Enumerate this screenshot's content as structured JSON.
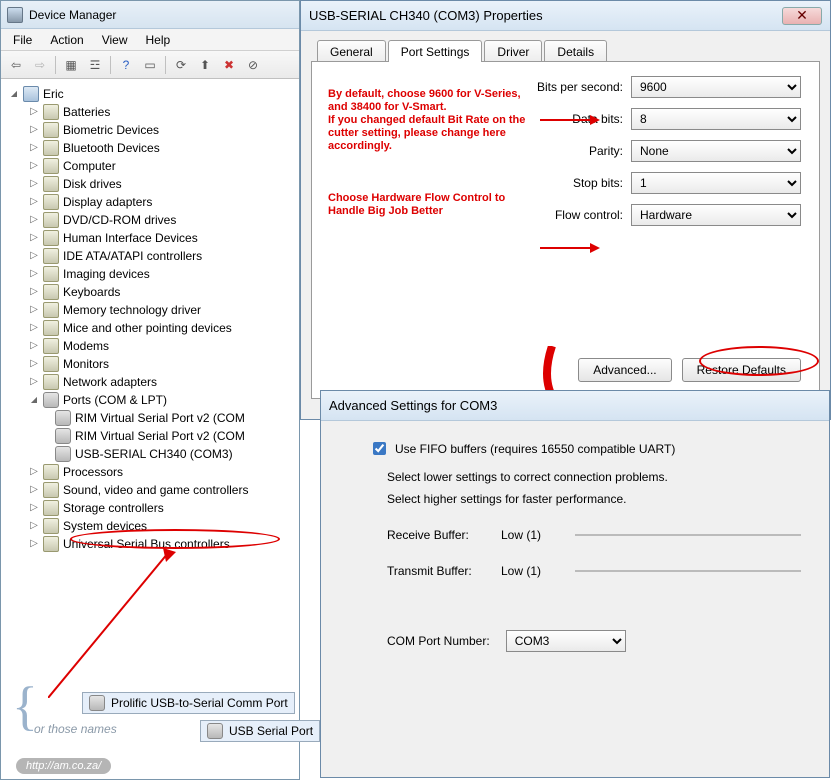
{
  "dm": {
    "title": "Device Manager",
    "menu": {
      "file": "File",
      "action": "Action",
      "view": "View",
      "help": "Help"
    },
    "root": "Eric",
    "items": [
      "Batteries",
      "Biometric Devices",
      "Bluetooth Devices",
      "Computer",
      "Disk drives",
      "Display adapters",
      "DVD/CD-ROM drives",
      "Human Interface Devices",
      "IDE ATA/ATAPI controllers",
      "Imaging devices",
      "Keyboards",
      "Memory technology driver",
      "Mice and other pointing devices",
      "Modems",
      "Monitors",
      "Network adapters"
    ],
    "ports_label": "Ports (COM & LPT)",
    "ports_children": [
      "RIM Virtual Serial Port v2 (COM",
      "RIM Virtual Serial Port v2 (COM",
      "USB-SERIAL CH340 (COM3)"
    ],
    "items_after": [
      "Processors",
      "Sound, video and game controllers",
      "Storage controllers",
      "System devices",
      "Universal Serial Bus controllers"
    ]
  },
  "prop": {
    "title": "USB-SERIAL CH340 (COM3) Properties",
    "tabs": {
      "general": "General",
      "port": "Port Settings",
      "driver": "Driver",
      "details": "Details"
    },
    "fields": {
      "bps_label": "Bits per second:",
      "bps_value": "9600",
      "data_label": "Data bits:",
      "data_value": "8",
      "parity_label": "Parity:",
      "parity_value": "None",
      "stop_label": "Stop bits:",
      "stop_value": "1",
      "flow_label": "Flow control:",
      "flow_value": "Hardware"
    },
    "note1": "By default, choose 9600 for V-Series, and 38400 for V-Smart.\nIf you changed default Bit Rate on the cutter setting, please change here accordingly.",
    "note2": "Choose Hardware Flow Control to Handle Big Job Better",
    "advanced_btn": "Advanced...",
    "restore_btn": "Restore Defaults"
  },
  "adv": {
    "title": "Advanced Settings for COM3",
    "fifo_label": "Use FIFO buffers (requires 16550 compatible UART)",
    "text1": "Select lower settings to correct connection problems.",
    "text2": "Select higher settings for faster performance.",
    "recv_label": "Receive Buffer:",
    "recv_low": "Low (1)",
    "xmit_label": "Transmit Buffer:",
    "xmit_low": "Low (1)",
    "comport_label": "COM Port Number:",
    "comport_value": "COM3"
  },
  "floats": {
    "port1": "Prolific USB-to-Serial Comm Port",
    "port2": "USB Serial Port",
    "or_those": "or those names",
    "url": "http://am.co.za/"
  }
}
